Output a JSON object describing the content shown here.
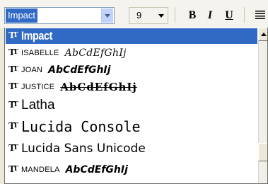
{
  "toolbar": {
    "font_name": "Impact",
    "font_size": "9",
    "bold_label": "B",
    "italic_label": "I",
    "underline_label": "U"
  },
  "font_list": {
    "items": [
      {
        "name": "Impact",
        "selected": true
      },
      {
        "name": "ISABELLE",
        "sample": "AbCdEfGhIj"
      },
      {
        "name": "JOAN",
        "sample": "AbCdEfGhIj"
      },
      {
        "name": "JUSTICE",
        "sample": "AbCdEfGhIj"
      },
      {
        "name": "Latha"
      },
      {
        "name": "Lucida Console"
      },
      {
        "name": "Lucida Sans Unicode"
      },
      {
        "name": "MANDELA",
        "sample": "AbCdEfGhIj"
      }
    ],
    "truetype_icon": "truetype-font-icon"
  },
  "colors": {
    "selection": "#316ac5",
    "toolbar_bg": "#f4f3ee"
  }
}
